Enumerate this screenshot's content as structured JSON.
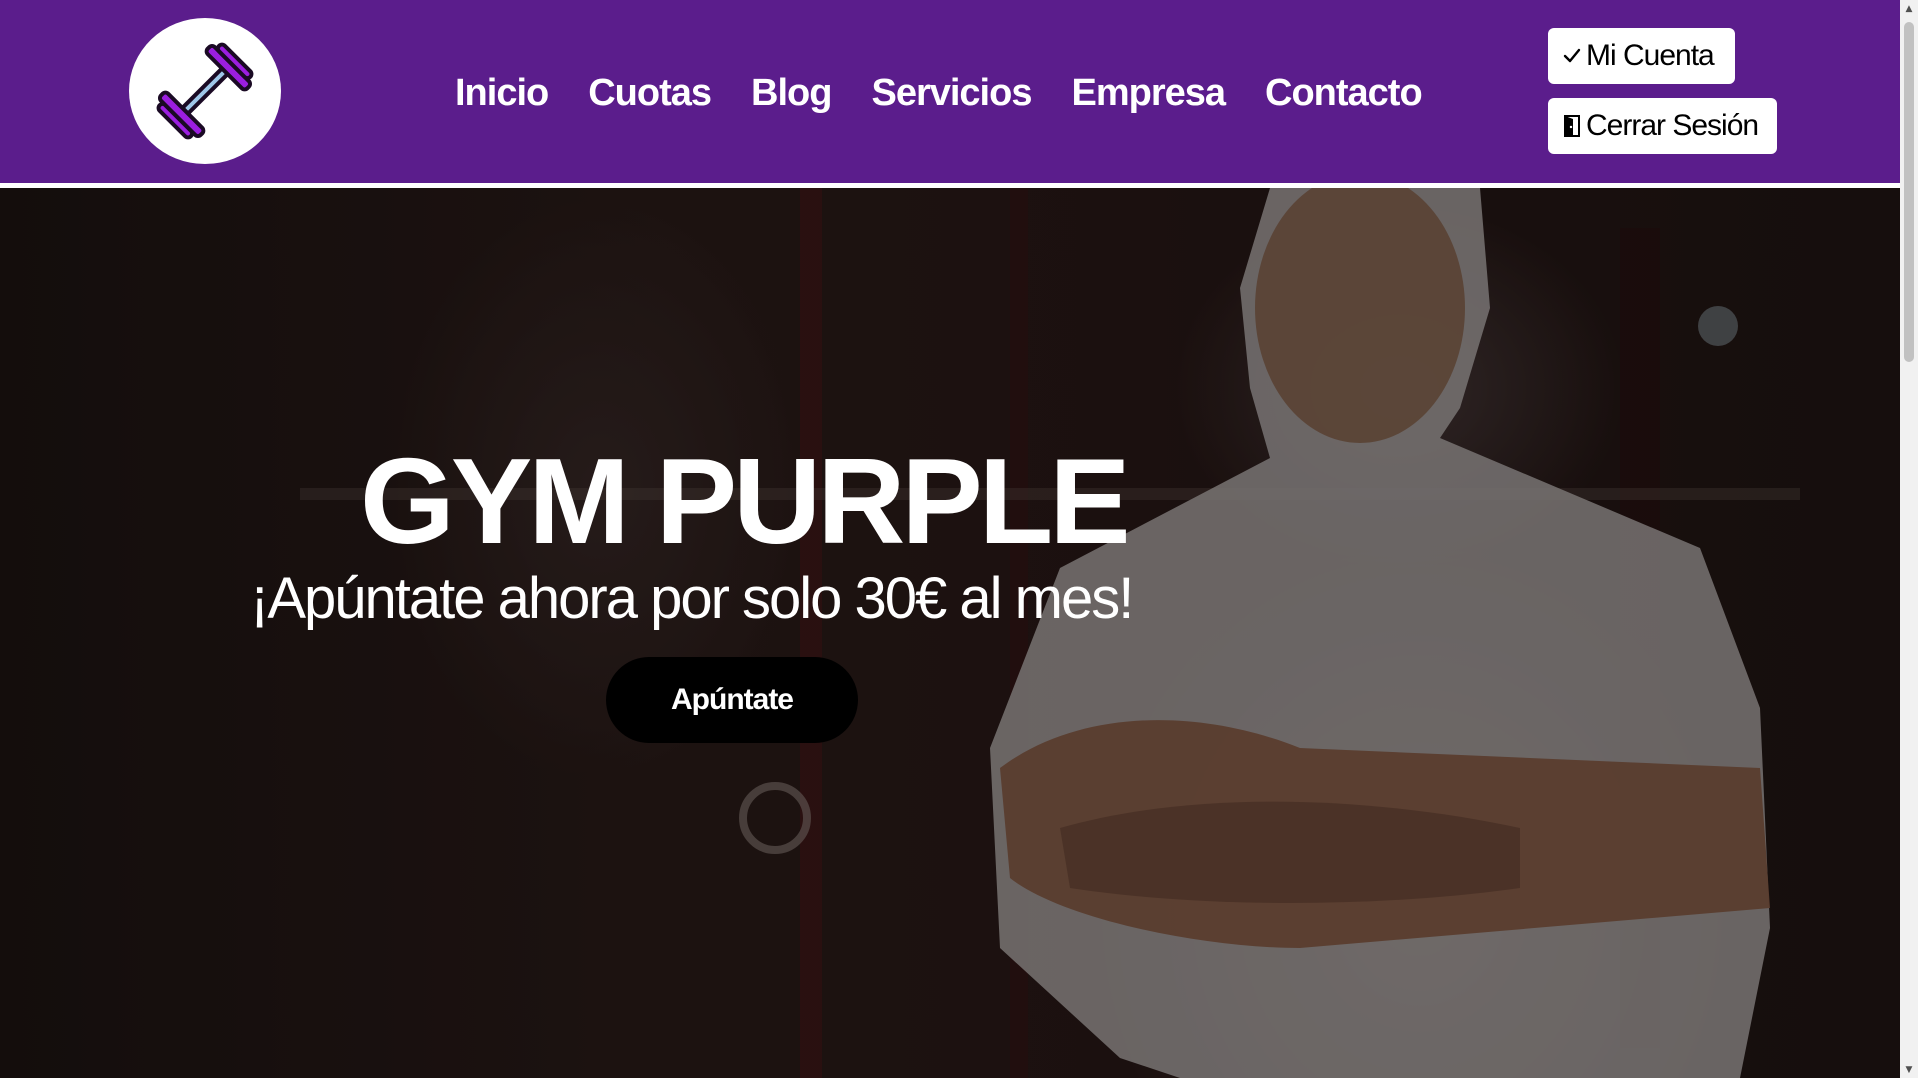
{
  "header": {
    "logo_icon": "dumbbell-icon",
    "nav": [
      {
        "label": "Inicio"
      },
      {
        "label": "Cuotas"
      },
      {
        "label": "Blog"
      },
      {
        "label": "Servicios"
      },
      {
        "label": "Empresa"
      },
      {
        "label": "Contacto"
      }
    ],
    "account_button": {
      "icon": "check-icon",
      "label": "Mi Cuenta"
    },
    "logout_button": {
      "icon": "door-icon",
      "label": "Cerrar Sesión"
    }
  },
  "hero": {
    "title": "GYM PURPLE",
    "subtitle": "¡Apúntate ahora por solo 30€ al mes!",
    "cta_label": "Apúntate"
  },
  "colors": {
    "header_bg": "#5b1d8c",
    "logo_purple": "#9b1ee0",
    "cta_bg": "#000000",
    "text_light": "#ffffff"
  }
}
